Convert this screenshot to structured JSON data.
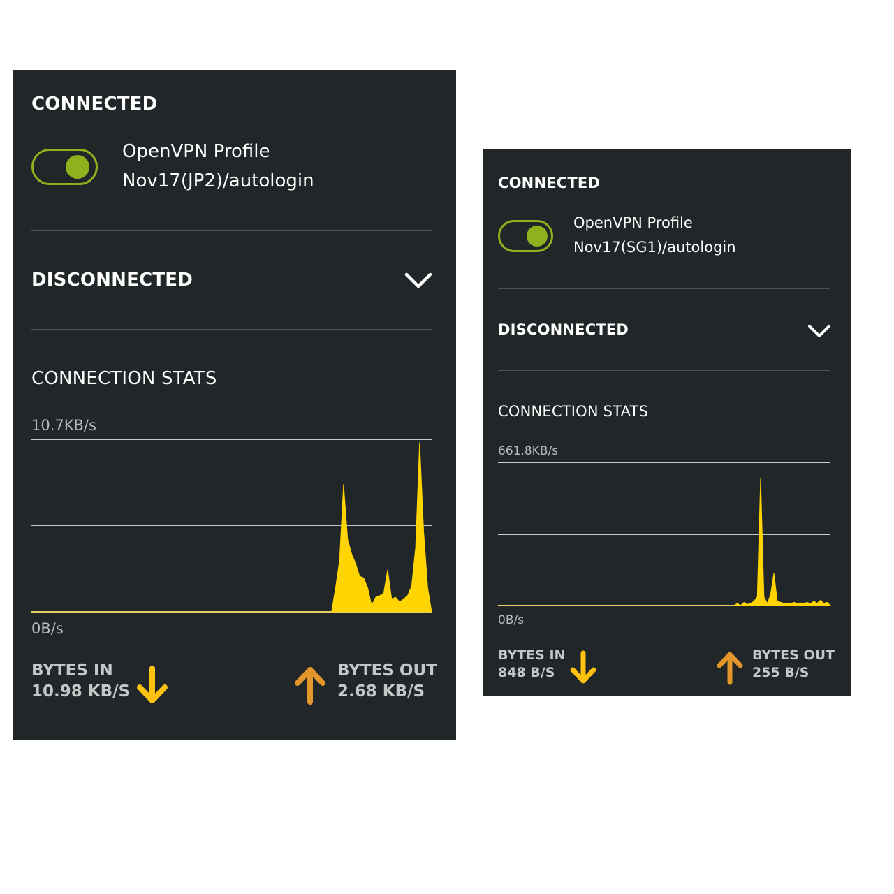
{
  "colors": {
    "panel_bg": "#212628",
    "toggle_green": "#8fb11d",
    "chart_yellow": "#ffd400",
    "arrow_down_yellow": "#ffc20e",
    "arrow_up_orange": "#e3962a"
  },
  "icons": {
    "section_toggle": "chevron-down-icon",
    "bytes_in": "arrow-down-icon",
    "bytes_out": "arrow-up-icon"
  },
  "panels": [
    {
      "connected_title": "CONNECTED",
      "toggle_on": true,
      "profile_name": "OpenVPN Profile",
      "profile_id": "Nov17(JP2)/autologin",
      "disconnected_title": "DISCONNECTED",
      "stats_title": "CONNECTION STATS",
      "chart_max_label": "10.7KB/s",
      "chart_min_label": "0B/s",
      "bytes_in_label": "BYTES IN",
      "bytes_in_value": "10.98 KB/S",
      "bytes_out_label": "BYTES OUT",
      "bytes_out_value": "2.68 KB/S"
    },
    {
      "connected_title": "CONNECTED",
      "toggle_on": true,
      "profile_name": "OpenVPN Profile",
      "profile_id": "Nov17(SG1)/autologin",
      "disconnected_title": "DISCONNECTED",
      "stats_title": "CONNECTION STATS",
      "chart_max_label": "661.8KB/s",
      "chart_min_label": "0B/s",
      "bytes_in_label": "BYTES IN",
      "bytes_in_value": "848 B/S",
      "bytes_out_label": "BYTES OUT",
      "bytes_out_value": "255 B/S"
    }
  ],
  "chart_data": [
    {
      "type": "area",
      "title": "",
      "xlabel": "",
      "ylabel": "",
      "ylim": [
        0,
        10.7
      ],
      "y_unit": "KB/s",
      "grid": true,
      "series": [
        {
          "x": [
            0,
            50,
            75,
            76,
            77,
            78,
            79,
            80,
            81,
            82,
            83,
            84,
            85,
            86,
            87,
            88,
            89,
            90,
            91,
            92,
            93,
            94,
            95,
            96,
            97,
            98,
            99,
            100
          ],
          "values": [
            0,
            0,
            0,
            1.5,
            3.2,
            7.9,
            4.5,
            3.6,
            3.0,
            2.2,
            2.1,
            1.5,
            0.4,
            0.9,
            1.0,
            1.1,
            2.6,
            0.8,
            0.9,
            0.6,
            0.8,
            1.0,
            1.6,
            4.0,
            10.5,
            5.0,
            1.5,
            0
          ]
        }
      ]
    },
    {
      "type": "area",
      "title": "",
      "xlabel": "",
      "ylabel": "",
      "ylim": [
        0,
        661.8
      ],
      "y_unit": "KB/s",
      "grid": true,
      "series": [
        {
          "x": [
            0,
            50,
            71,
            72,
            73,
            74,
            75,
            76,
            77,
            78,
            79,
            80,
            81,
            82,
            83,
            84,
            85,
            86,
            87,
            88,
            89,
            90,
            91,
            92,
            93,
            94,
            95,
            96,
            97,
            98,
            99,
            100
          ],
          "values": [
            0,
            0,
            0,
            10,
            0,
            15,
            5,
            10,
            20,
            40,
            590,
            40,
            10,
            50,
            150,
            20,
            15,
            10,
            12,
            8,
            15,
            10,
            12,
            10,
            15,
            8,
            20,
            10,
            25,
            10,
            15,
            0
          ]
        }
      ]
    }
  ]
}
